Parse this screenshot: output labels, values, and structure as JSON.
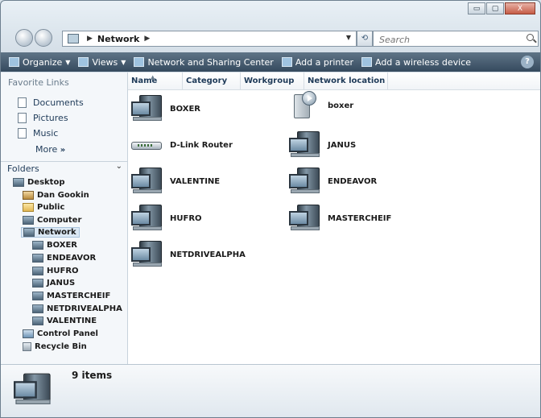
{
  "window": {
    "buttons": {
      "minimize": "▭",
      "maximize": "▢",
      "close": "X"
    }
  },
  "address": {
    "path": "Network",
    "search_placeholder": "Search"
  },
  "toolbar": {
    "organize": "Organize",
    "views": "Views",
    "network_center": "Network and Sharing Center",
    "add_printer": "Add a printer",
    "add_wireless": "Add a wireless device",
    "help": "?"
  },
  "favorites": {
    "title": "Favorite Links",
    "items": [
      "Documents",
      "Pictures",
      "Music"
    ],
    "more": "More",
    "more_glyph": "»"
  },
  "folders": {
    "label": "Folders",
    "tree": [
      {
        "label": "Desktop"
      },
      {
        "label": "Dan Gookin"
      },
      {
        "label": "Public"
      },
      {
        "label": "Computer"
      },
      {
        "label": "Network"
      },
      {
        "label": "BOXER"
      },
      {
        "label": "ENDEAVOR"
      },
      {
        "label": "HUFRO"
      },
      {
        "label": "JANUS"
      },
      {
        "label": "MASTERCHEIF"
      },
      {
        "label": "NETDRIVEALPHA"
      },
      {
        "label": "VALENTINE"
      },
      {
        "label": "Control Panel"
      },
      {
        "label": "Recycle Bin"
      }
    ]
  },
  "columns": [
    "Name",
    "Category",
    "Workgroup",
    "Network location"
  ],
  "devices": [
    {
      "label": "BOXER",
      "type": "computer"
    },
    {
      "label": "boxer",
      "type": "media"
    },
    {
      "label": "D-Link Router",
      "type": "router"
    },
    {
      "label": "JANUS",
      "type": "computer"
    },
    {
      "label": "VALENTINE",
      "type": "computer"
    },
    {
      "label": "ENDEAVOR",
      "type": "computer"
    },
    {
      "label": "HUFRO",
      "type": "computer"
    },
    {
      "label": "MASTERCHEIF",
      "type": "computer"
    },
    {
      "label": "NETDRIVEALPHA",
      "type": "computer"
    }
  ],
  "details": {
    "count": "9 items"
  }
}
